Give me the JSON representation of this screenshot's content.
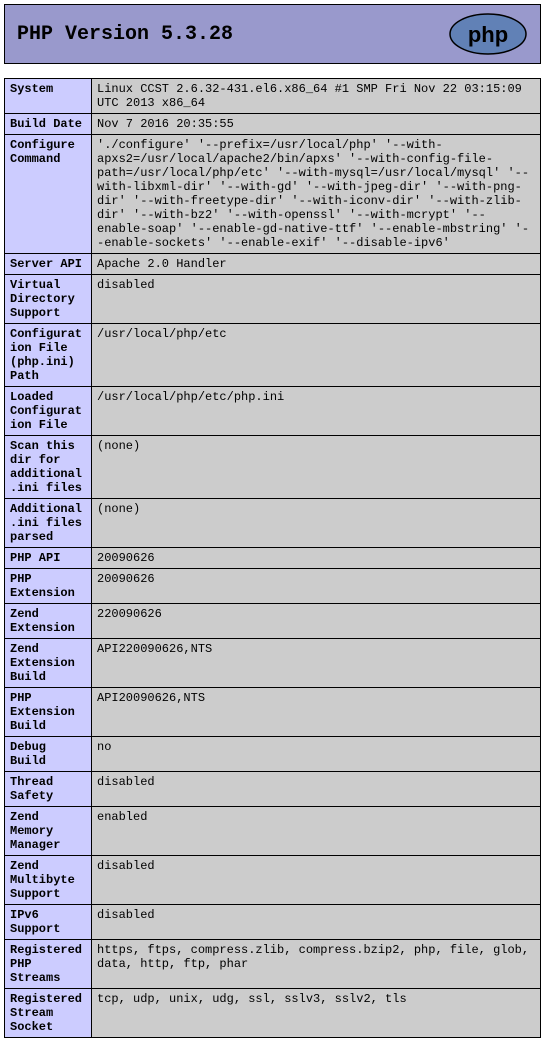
{
  "header": {
    "title": "PHP Version 5.3.28",
    "logo_text": "php"
  },
  "rows": [
    {
      "label": "System",
      "value": "Linux CCST 2.6.32-431.el6.x86_64 #1 SMP Fri Nov 22 03:15:09 UTC 2013 x86_64"
    },
    {
      "label": "Build Date",
      "value": "Nov 7 2016 20:35:55"
    },
    {
      "label": "Configure Command",
      "value": "'./configure' '--prefix=/usr/local/php' '--with-apxs2=/usr/local/apache2/bin/apxs' '--with-config-file-path=/usr/local/php/etc' '--with-mysql=/usr/local/mysql' '--with-libxml-dir' '--with-gd' '--with-jpeg-dir' '--with-png-dir' '--with-freetype-dir' '--with-iconv-dir' '--with-zlib-dir' '--with-bz2' '--with-openssl' '--with-mcrypt' '--enable-soap' '--enable-gd-native-ttf' '--enable-mbstring' '--enable-sockets' '--enable-exif' '--disable-ipv6'"
    },
    {
      "label": "Server API",
      "value": "Apache 2.0 Handler"
    },
    {
      "label": "Virtual Directory Support",
      "value": "disabled"
    },
    {
      "label": "Configuration File (php.ini) Path",
      "value": "/usr/local/php/etc"
    },
    {
      "label": "Loaded Configuration File",
      "value": "/usr/local/php/etc/php.ini"
    },
    {
      "label": "Scan this dir for additional .ini files",
      "value": "(none)"
    },
    {
      "label": "Additional .ini files parsed",
      "value": "(none)"
    },
    {
      "label": "PHP API",
      "value": "20090626"
    },
    {
      "label": "PHP Extension",
      "value": "20090626"
    },
    {
      "label": "Zend Extension",
      "value": "220090626"
    },
    {
      "label": "Zend Extension Build",
      "value": "API220090626,NTS"
    },
    {
      "label": "PHP Extension Build",
      "value": "API20090626,NTS"
    },
    {
      "label": "Debug Build",
      "value": "no"
    },
    {
      "label": "Thread Safety",
      "value": "disabled"
    },
    {
      "label": "Zend Memory Manager",
      "value": "enabled"
    },
    {
      "label": "Zend Multibyte Support",
      "value": "disabled"
    },
    {
      "label": "IPv6 Support",
      "value": "disabled"
    },
    {
      "label": "Registered PHP Streams",
      "value": "https, ftps, compress.zlib, compress.bzip2, php, file, glob, data, http, ftp, phar"
    },
    {
      "label": "Registered Stream Socket",
      "value": "tcp, udp, unix, udg, ssl, sslv3, sslv2, tls"
    }
  ]
}
